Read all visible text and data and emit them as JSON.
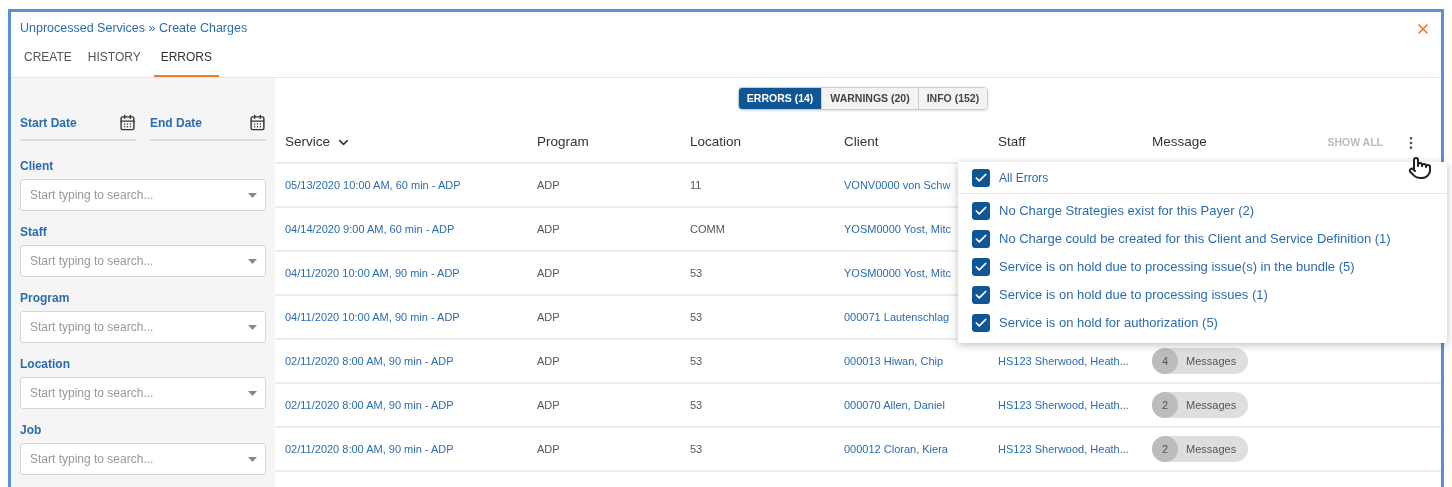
{
  "breadcrumb": "Unprocessed Services » Create Charges",
  "tabs": [
    {
      "label": "CREATE",
      "selected": false
    },
    {
      "label": "HISTORY",
      "selected": false
    },
    {
      "label": "ERRORS",
      "selected": true
    }
  ],
  "filters": {
    "dates": [
      {
        "label": "Start Date"
      },
      {
        "label": "End Date"
      }
    ],
    "searches": [
      {
        "label": "Client",
        "placeholder": "Start typing to search..."
      },
      {
        "label": "Staff",
        "placeholder": "Start typing to search..."
      },
      {
        "label": "Program",
        "placeholder": "Start typing to search..."
      },
      {
        "label": "Location",
        "placeholder": "Start typing to search..."
      },
      {
        "label": "Job",
        "placeholder": "Start typing to search..."
      }
    ]
  },
  "segments": [
    {
      "label": "ERRORS (14)",
      "selected": true
    },
    {
      "label": "WARNINGS (20)",
      "selected": false
    },
    {
      "label": "INFO (152)",
      "selected": false
    }
  ],
  "table": {
    "columns": [
      {
        "label": "Service",
        "sorted": true
      },
      {
        "label": "Program",
        "sorted": false
      },
      {
        "label": "Location",
        "sorted": false
      },
      {
        "label": "Client",
        "sorted": false
      },
      {
        "label": "Staff",
        "sorted": false
      },
      {
        "label": "Message",
        "sorted": false
      }
    ],
    "show_all": "SHOW ALL",
    "rows": [
      {
        "service": "05/13/2020 10:00 AM, 60 min - ADP",
        "program": "ADP",
        "location": "11",
        "client": "VONV0000 von Schw"
      },
      {
        "service": "04/14/2020 9:00 AM, 60 min - ADP",
        "program": "ADP",
        "location": "COMM",
        "client": "YOSM0000 Yost, Mitc"
      },
      {
        "service": "04/11/2020 10:00 AM, 90 min - ADP",
        "program": "ADP",
        "location": "53",
        "client": "YOSM0000 Yost, Mitc"
      },
      {
        "service": "04/11/2020 10:00 AM, 90 min - ADP",
        "program": "ADP",
        "location": "53",
        "client": "000071 Lautenschlag"
      },
      {
        "service": "02/11/2020 8:00 AM, 90 min - ADP",
        "program": "ADP",
        "location": "53",
        "client": "000013 Hiwan, Chip",
        "staff": "HS123 Sherwood, Heath...",
        "message": {
          "count": "4",
          "label": "Messages"
        }
      },
      {
        "service": "02/11/2020 8:00 AM, 90 min - ADP",
        "program": "ADP",
        "location": "53",
        "client": "000070 Allen, Daniel",
        "staff": "HS123 Sherwood, Heath...",
        "message": {
          "count": "2",
          "label": "Messages"
        }
      },
      {
        "service": "02/11/2020 8:00 AM, 90 min - ADP",
        "program": "ADP",
        "location": "53",
        "client": "000012 Cloran, Kiera",
        "staff": "HS123 Sherwood, Heath...",
        "message": {
          "count": "2",
          "label": "Messages"
        }
      }
    ]
  },
  "filter_menu": {
    "items": [
      {
        "kind": "all",
        "label": "All Errors",
        "checked": true
      },
      {
        "kind": "item",
        "label": "No Charge Strategies exist for this Payer (2)",
        "checked": true
      },
      {
        "kind": "item",
        "label": "No Charge could be created for this Client and Service Definition (1)",
        "checked": true
      },
      {
        "kind": "item",
        "label": "Service is on hold due to processing issue(s) in the bundle (5)",
        "checked": true
      },
      {
        "kind": "item",
        "label": "Service is on hold due to processing issues (1)",
        "checked": true
      },
      {
        "kind": "item",
        "label": "Service is on hold for authorization (5)",
        "checked": true
      }
    ]
  }
}
